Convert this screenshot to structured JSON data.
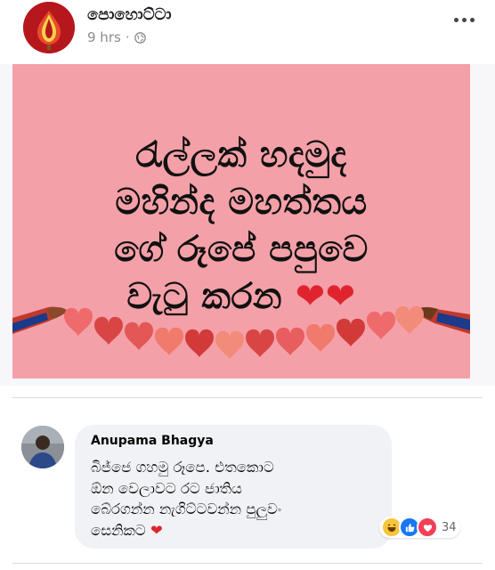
{
  "header": {
    "page_name": "පොහොට්ටා",
    "time": "9 hrs",
    "separator": "·",
    "privacy_icon": "globe-icon",
    "more_icon": "more-horizontal-icon"
  },
  "image": {
    "lines": [
      "රැල්ලක් හදමුද",
      "මහින්ද මහත්තය",
      "ගේ රූපේ පපුවෙ",
      "වැටු කරන"
    ],
    "hearts": "❤❤",
    "background_color": "#f4a0a8"
  },
  "comment": {
    "author": "Anupama Bhagya",
    "lines": [
      "බිජ්ජෙ ගහමු රූපෙ. එතකොට",
      "ඕන වෙලාවට රට ජාතිය",
      "බේරගන්න නැගිට්ටවන්න පුලුවං",
      "සෙනිකට"
    ],
    "heart": "❤",
    "reactions": [
      "haha-reaction-icon",
      "like-reaction-icon",
      "love-reaction-icon"
    ],
    "reaction_count": "34"
  }
}
